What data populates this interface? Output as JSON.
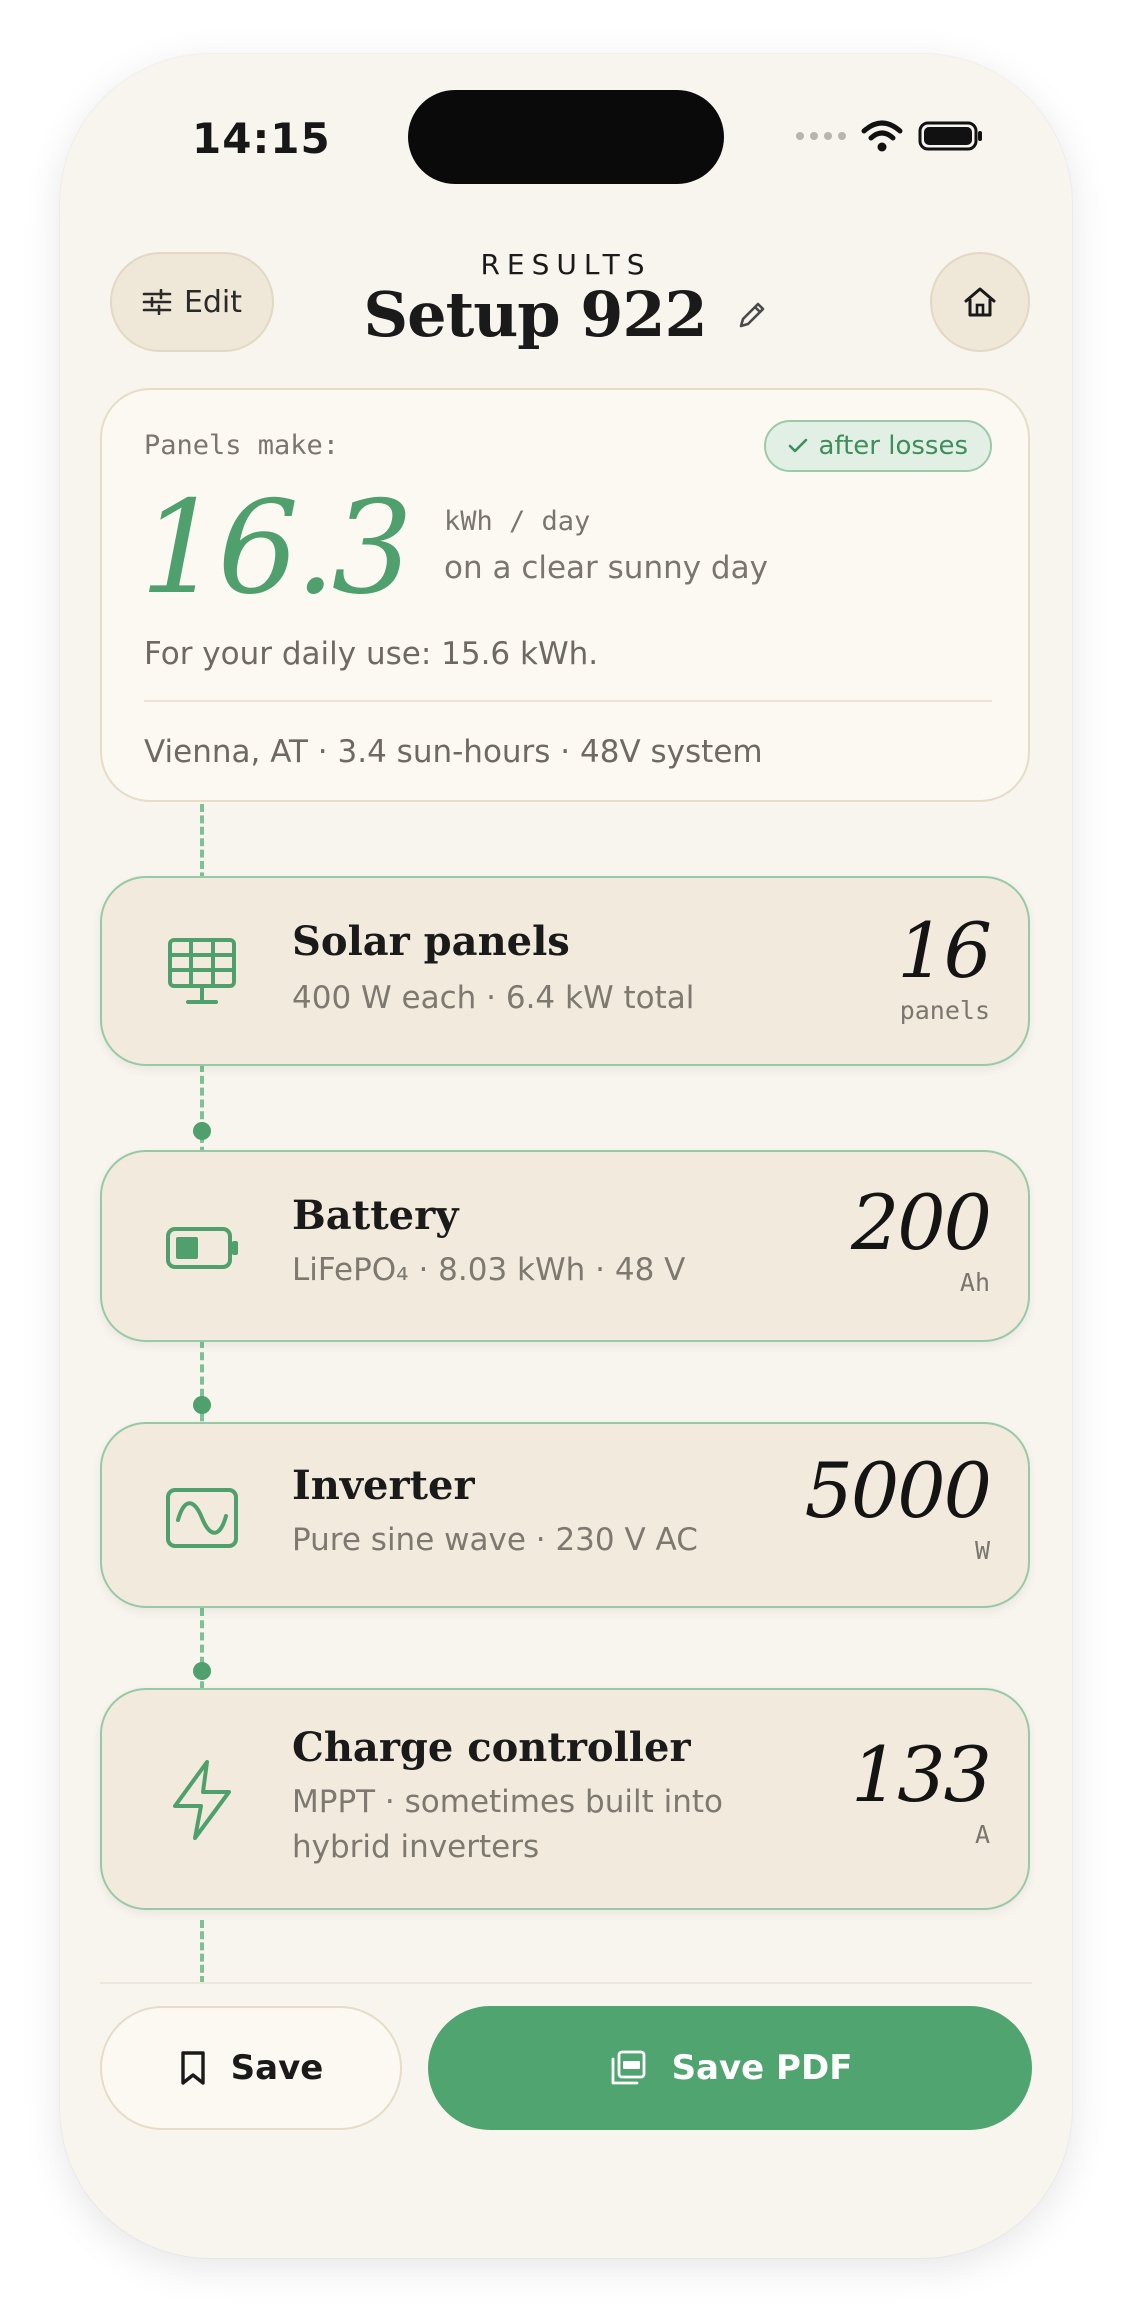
{
  "status_bar": {
    "time": "14:15"
  },
  "header": {
    "edit_label": "Edit",
    "eyebrow": "RESULTS",
    "title": "Setup 922"
  },
  "summary": {
    "label": "Panels make:",
    "badge": "after losses",
    "value": "16.3",
    "unit": "kWh / day",
    "unit_note": "on a clear sunny day",
    "daily_use": "For your daily use: 15.6 kWh.",
    "location_line": "Vienna, AT · 3.4 sun-hours · 48V system"
  },
  "components": [
    {
      "title": "Solar panels",
      "desc": "400 W each · 6.4 kW total",
      "value": "16",
      "unit": "panels",
      "icon": "solar-panel-icon"
    },
    {
      "title": "Battery",
      "desc": "LiFePO₄ · 8.03 kWh · 48 V",
      "value": "200",
      "unit": "Ah",
      "icon": "battery-icon"
    },
    {
      "title": "Inverter",
      "desc": "Pure sine wave · 230 V AC",
      "value": "5000",
      "unit": "W",
      "icon": "sine-wave-icon"
    },
    {
      "title": "Charge controller",
      "desc": "MPPT · sometimes built into hybrid inverters",
      "value": "133",
      "unit": "A",
      "icon": "lightning-icon"
    }
  ],
  "actions": {
    "save_label": "Save",
    "pdf_label": "Save PDF"
  },
  "colors": {
    "accent": "#50a46f",
    "background": "#f8f4ee",
    "card": "#f2ebdd"
  }
}
